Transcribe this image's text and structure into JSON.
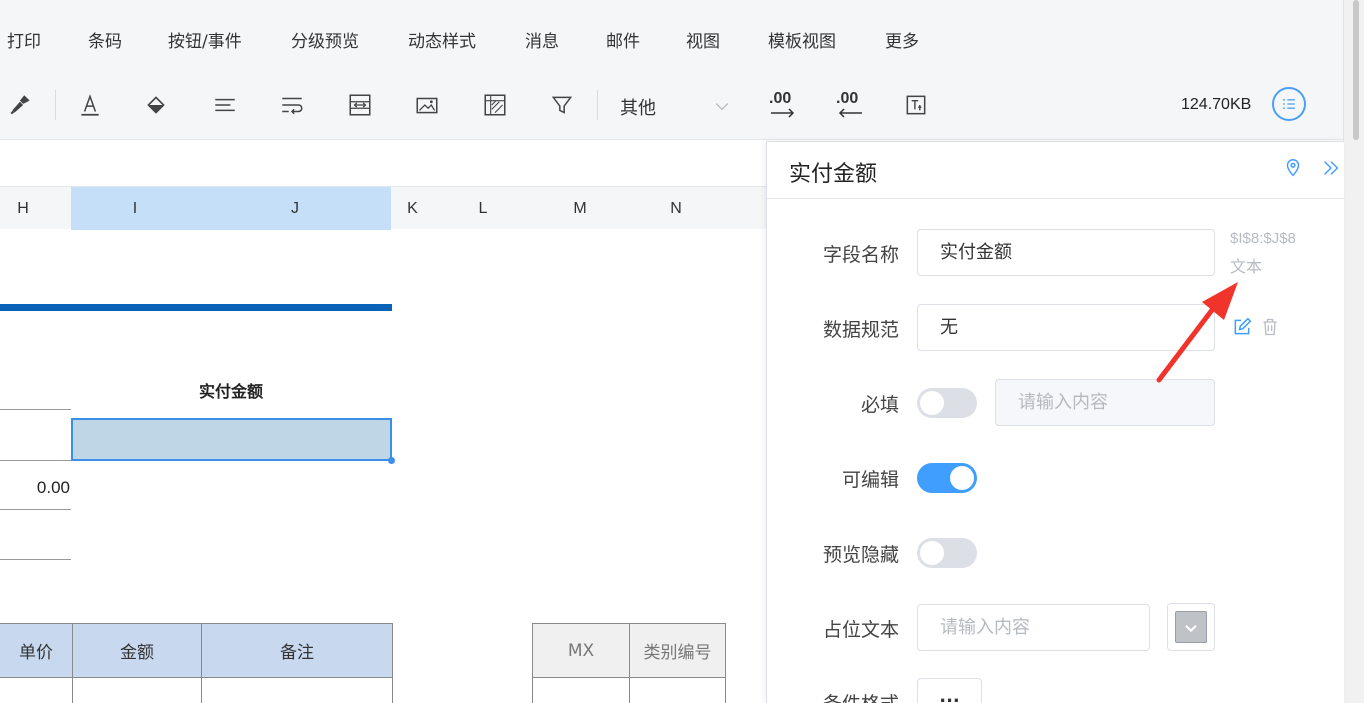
{
  "menubar": {
    "items": [
      "打印",
      "条码",
      "按钮/事件",
      "分级预览",
      "动态样式",
      "消息",
      "邮件",
      "视图",
      "模板视图",
      "更多"
    ]
  },
  "toolbar": {
    "icons": [
      "format-painter-icon",
      "font-color-icon",
      "fill-color-icon",
      "align-icon",
      "wrap-text-icon",
      "merge-cells-icon",
      "image-icon",
      "freeze-icon",
      "filter-icon",
      "increase-decimal-icon",
      "decrease-decimal-icon",
      "text-format-icon",
      "list-icon"
    ],
    "other_select": "其他",
    "increase_decimal_label": ".00",
    "decrease_decimal_label": ".00",
    "file_size": "124.70KB"
  },
  "sheet": {
    "columns": [
      "H",
      "I",
      "J",
      "K",
      "L",
      "M",
      "N"
    ],
    "selected_columns": [
      "I",
      "J"
    ],
    "field_title": "实付金额",
    "amount": "0.00",
    "table1_headers": [
      "单价",
      "金额",
      "备注"
    ],
    "table2_headers": [
      "MX",
      "类别编号"
    ],
    "band_color": "#0b63b8",
    "selection_color": "#3b8fe8"
  },
  "panel": {
    "title": "实付金额",
    "field_name_label": "字段名称",
    "field_name_value": "实付金额",
    "cell_ref": "$I$8:$J$8",
    "cell_type": "文本",
    "data_spec_label": "数据规范",
    "data_spec_value": "无",
    "required_label": "必填",
    "required_on": false,
    "required_placeholder": "请输入内容",
    "editable_label": "可编辑",
    "editable_on": true,
    "preview_hidden_label": "预览隐藏",
    "preview_hidden_on": false,
    "placeholder_label": "占位文本",
    "placeholder_input_placeholder": "请输入内容",
    "conditional_format_label": "条件格式",
    "more_button": "...",
    "accent_color": "#409eff"
  }
}
